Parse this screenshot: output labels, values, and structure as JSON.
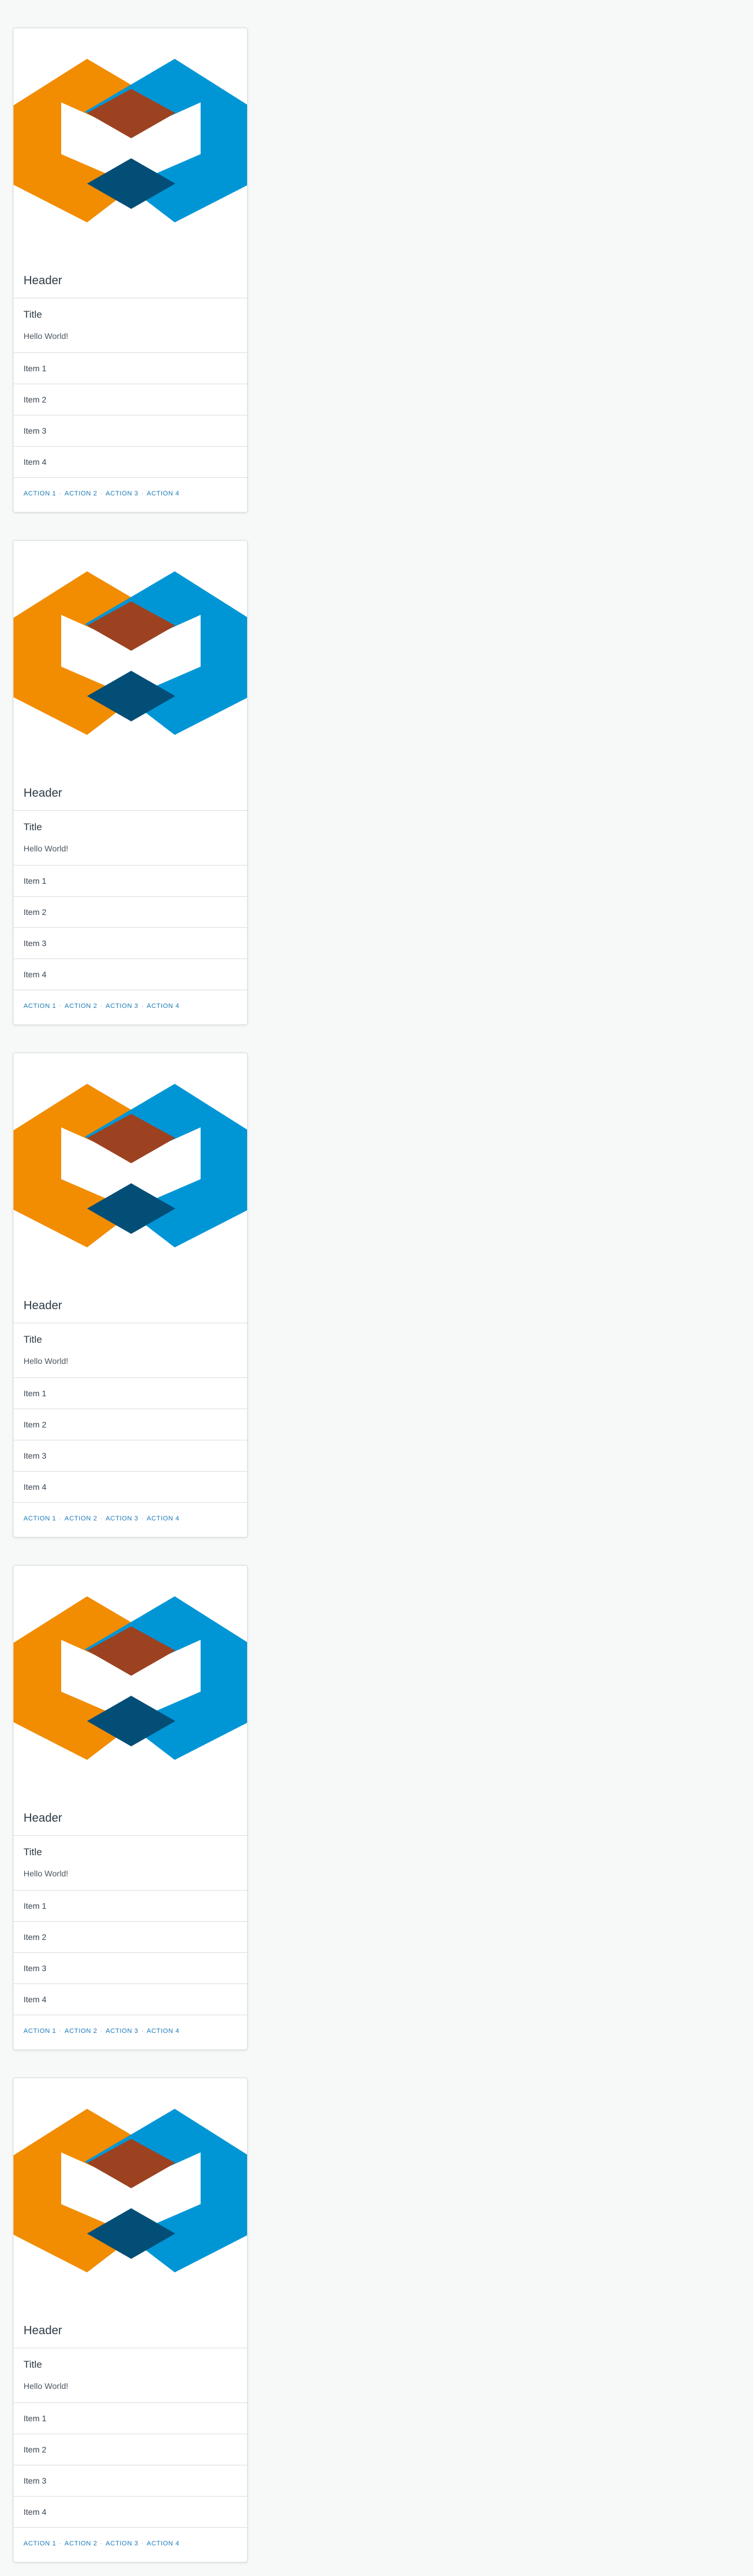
{
  "logo": {
    "colors": {
      "orange": "#f28c00",
      "blue": "#0096d6",
      "overlap_top": "#9c4221",
      "overlap_bottom": "#034e76"
    }
  },
  "cards": [
    {
      "header": "Header",
      "title": "Title",
      "subtitle": "Hello World!",
      "items": [
        "Item 1",
        "Item 2",
        "Item 3",
        "Item 4"
      ],
      "actions": [
        "Action 1",
        "Action 2",
        "Action 3",
        "Action 4"
      ],
      "separator": "·"
    },
    {
      "header": "Header",
      "title": "Title",
      "subtitle": "Hello World!",
      "items": [
        "Item 1",
        "Item 2",
        "Item 3",
        "Item 4"
      ],
      "actions": [
        "Action 1",
        "Action 2",
        "Action 3",
        "Action 4"
      ],
      "separator": "·"
    },
    {
      "header": "Header",
      "title": "Title",
      "subtitle": "Hello World!",
      "items": [
        "Item 1",
        "Item 2",
        "Item 3",
        "Item 4"
      ],
      "actions": [
        "Action 1",
        "Action 2",
        "Action 3",
        "Action 4"
      ],
      "separator": "·"
    },
    {
      "header": "Header",
      "title": "Title",
      "subtitle": "Hello World!",
      "items": [
        "Item 1",
        "Item 2",
        "Item 3",
        "Item 4"
      ],
      "actions": [
        "Action 1",
        "Action 2",
        "Action 3",
        "Action 4"
      ],
      "separator": "·"
    },
    {
      "header": "Header",
      "title": "Title",
      "subtitle": "Hello World!",
      "items": [
        "Item 1",
        "Item 2",
        "Item 3",
        "Item 4"
      ],
      "actions": [
        "Action 1",
        "Action 2",
        "Action 3",
        "Action 4"
      ],
      "separator": "·"
    }
  ]
}
